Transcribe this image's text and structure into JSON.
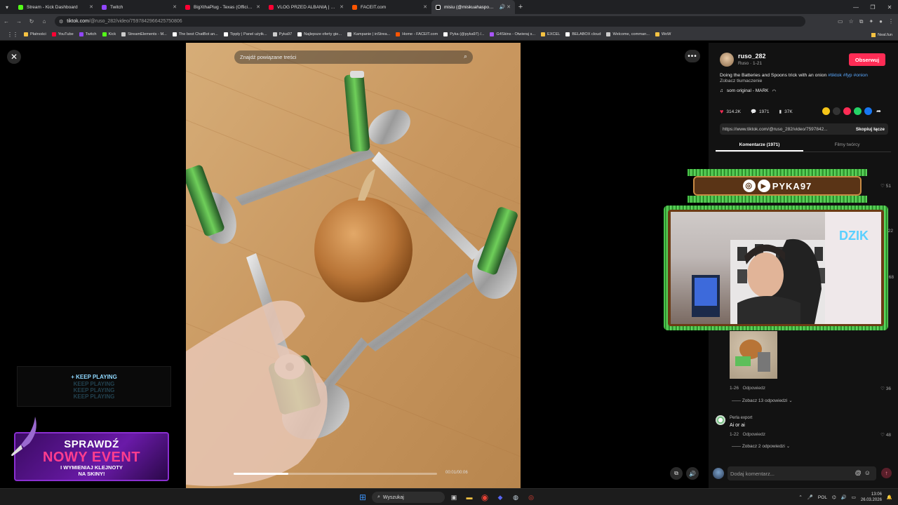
{
  "browser": {
    "tabs": [
      {
        "title": "Stream - Kick Dashboard",
        "color": "#53fc18"
      },
      {
        "title": "Twitch",
        "color": "#9146ff"
      },
      {
        "title": "BigXthaPlug - Texas (Official M",
        "color": "#ff0033"
      },
      {
        "title": "VLOG PRZED ALBANIĄ | Cały vi",
        "color": "#ff0033"
      },
      {
        "title": "FACEIT.com",
        "color": "#ff5500"
      },
      {
        "title": "misiu (@miskuahaspoko) | ",
        "color": "#ffffff"
      }
    ],
    "url_host": "tiktok.com",
    "url_path": "/@ruso_282/video/7597842966425750806",
    "bookmarks": [
      {
        "label": "Płatności",
        "color": "#f5c242"
      },
      {
        "label": "YouTube",
        "color": "#ff0033"
      },
      {
        "label": "Twitch",
        "color": "#9146ff"
      },
      {
        "label": "Kick",
        "color": "#53fc18"
      },
      {
        "label": "StreamElements - M...",
        "color": "#cccccc"
      },
      {
        "label": "The best ChatBot an...",
        "color": "#ffffff"
      },
      {
        "label": "Tipply | Panel użytk...",
        "color": "#ffffff"
      },
      {
        "label": "Pyka97",
        "color": "#cccccc"
      },
      {
        "label": "Najlepsze oferty gie...",
        "color": "#ffffff"
      },
      {
        "label": "Kampanie | inStrea...",
        "color": "#cccccc"
      },
      {
        "label": "Home - FACEIT.com",
        "color": "#ff5500"
      },
      {
        "label": "Pyka (@pyka97) /...",
        "color": "#ffffff"
      },
      {
        "label": "G4Skins - Otwieraj s...",
        "color": "#a855f7"
      },
      {
        "label": "EXCEL",
        "color": "#f5c242"
      },
      {
        "label": "BELABOX cloud",
        "color": "#ffffff"
      },
      {
        "label": "Welcome, comman...",
        "color": "#cccccc"
      },
      {
        "label": "WoW",
        "color": "#f5c242"
      }
    ],
    "bookmark_last": "Neal.fun"
  },
  "player": {
    "search_placeholder": "Znajdź powiązane treści",
    "time": "00:01/00:06",
    "progress": 0.27
  },
  "overlays": {
    "keep_playing": "+ KEEP PLAYING",
    "keep_echo": "KEEP PLAYING",
    "event_line1": "SPRAWDŹ",
    "event_line2": "NOWY EVENT",
    "event_line3": "I WYMIENIAJ KLEJNOTY",
    "event_line4": "NA SKINY!",
    "pyka_label": "PYKA97"
  },
  "post": {
    "username": "ruso_282",
    "subline": "Ruso · 1-21",
    "follow": "Obserwuj",
    "desc": "Doing the Batteries and Spoons trick with an onion",
    "tags": "#tiktok #fyp #onion",
    "translate": "Zobacz tłumaczenie",
    "music": "som original - MARK",
    "likes": "314.2K",
    "comments": "1971",
    "saves": "37K",
    "link": "https://www.tiktok.com/@ruso_282/video/7597842...",
    "copy": "Skopiuj łącze",
    "tab_comments": "Komentarze (1971)",
    "tab_videos": "Filmy twórcy"
  },
  "comments": {
    "c1_likes": "51",
    "c1b_likes": "22",
    "c1c_likes": "68",
    "c2_date": "1-26",
    "c2_reply": "Odpowiedz",
    "c2_likes": "36",
    "c2_more": "Zobacz 13 odpowiedzi",
    "c3_name": "Perla export",
    "c3_text": "Ai or ai",
    "c3_date": "1-22",
    "c3_reply": "Odpowiedz",
    "c3_likes": "48",
    "c3_more": "Zobacz 2 odpowiedzi",
    "input_placeholder": "Dodaj komentarz..."
  },
  "taskbar": {
    "search": "Wyszukaj",
    "lang": "POL",
    "time": "13:06",
    "date": "26.03.2026"
  }
}
